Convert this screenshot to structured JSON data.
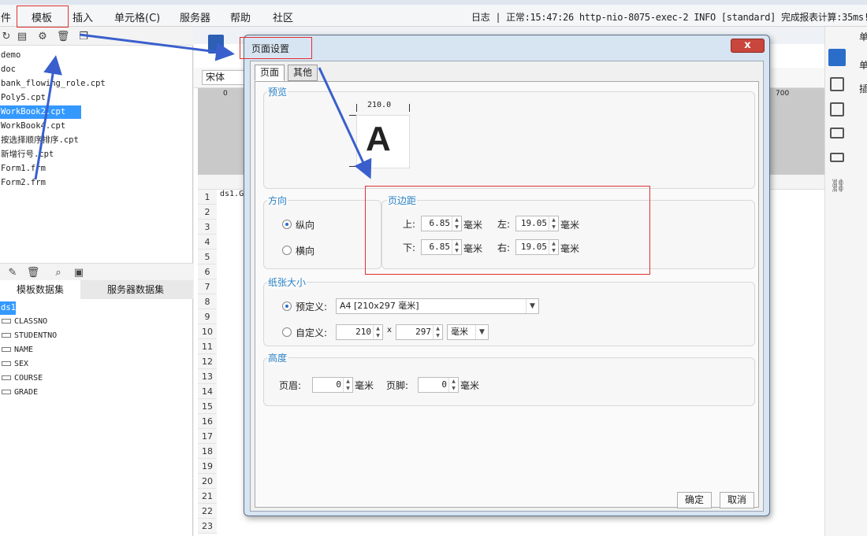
{
  "menubar": {
    "items": [
      "件",
      "模板",
      "插入",
      "单元格(C)",
      "服务器",
      "帮助",
      "社区"
    ],
    "log": "日志 | 正常:15:47:26 http-nio-8075-exec-2 INFO [standard] 完成报表计算:35ms!"
  },
  "files": [
    "demo",
    "doc",
    "bank_flowing_role.cpt",
    "Poly5.cpt",
    "WorkBook2.cpt",
    "WorkBook4.cpt",
    "按选择顺序排序.cpt",
    "新增行号.cpt",
    "Form1.frm",
    "Form2.frm"
  ],
  "dataset": {
    "tabs": [
      "模板数据集",
      "服务器数据集"
    ],
    "name": "ds1",
    "fields": [
      "CLASSNO",
      "STUDENTNO",
      "NAME",
      "SEX",
      "COURSE",
      "GRADE"
    ]
  },
  "editor": {
    "font": "宋体",
    "ruler_marks": [
      "0",
      "700"
    ],
    "cell_a1": "ds1.G",
    "row_numbers": [
      "1",
      "2",
      "3",
      "4",
      "5",
      "6",
      "7",
      "8",
      "9",
      "10",
      "11",
      "12",
      "13",
      "14",
      "15",
      "16",
      "17",
      "18",
      "19",
      "20",
      "21",
      "22",
      "23"
    ]
  },
  "right_panel": {
    "labels": [
      "单",
      "单",
      "插"
    ]
  },
  "dialog": {
    "title": "页面设置",
    "close": "x",
    "tabs": [
      "页面",
      "其他"
    ],
    "preview": {
      "title": "预览",
      "width_label": "210.0",
      "letter": "A"
    },
    "orientation": {
      "title": "方向",
      "portrait": "纵向",
      "landscape": "横向",
      "selected": "portrait"
    },
    "margins": {
      "title": "页边距",
      "top_label": "上:",
      "top": "6.85",
      "bottom_label": "下:",
      "bottom": "6.85",
      "left_label": "左:",
      "left": "19.05",
      "right_label": "右:",
      "right": "19.05",
      "unit": "毫米"
    },
    "paper": {
      "title": "纸张大小",
      "predefined_label": "预定义:",
      "predefined_value": "A4 [210x297 毫米]",
      "custom_label": "自定义:",
      "custom_w": "210",
      "times": "x",
      "custom_h": "297",
      "custom_unit": "毫米",
      "selected": "predefined"
    },
    "height": {
      "title": "高度",
      "header_label": "页眉:",
      "header_value": "0",
      "footer_label": "页脚:",
      "footer_value": "0",
      "unit": "毫米"
    },
    "ok": "确定",
    "cancel": "取消"
  },
  "colors": {
    "accent": "#2a82c8",
    "selection": "#3399ff",
    "annotation": "#e03030",
    "arrow": "#3a5fcd"
  }
}
